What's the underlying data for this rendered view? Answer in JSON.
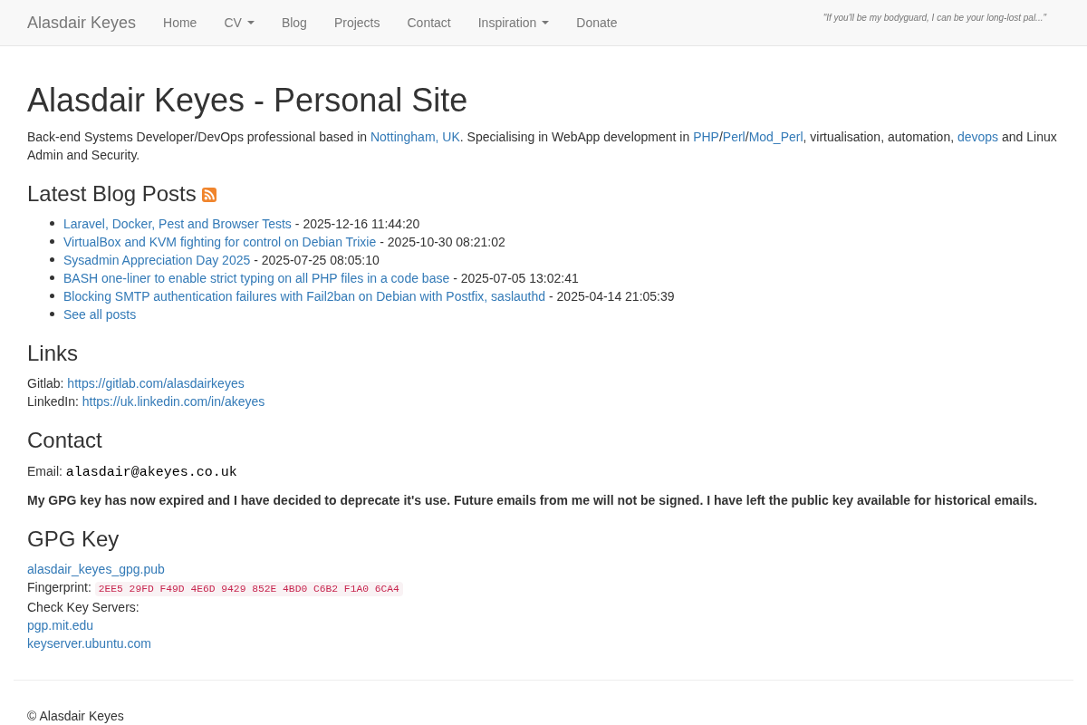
{
  "navbar": {
    "brand": "Alasdair Keyes",
    "items": [
      {
        "label": "Home",
        "kind": "link"
      },
      {
        "label": "CV",
        "kind": "dropdown"
      },
      {
        "label": "Blog",
        "kind": "link"
      },
      {
        "label": "Projects",
        "kind": "link"
      },
      {
        "label": "Contact",
        "kind": "link"
      },
      {
        "label": "Inspiration",
        "kind": "dropdown"
      },
      {
        "label": "Donate",
        "kind": "link"
      }
    ],
    "quote": "\"If you'll be my bodyguard, I can be your long-lost pal...\""
  },
  "header": {
    "title": "Alasdair Keyes - Personal Site",
    "intro": [
      {
        "kind": "text",
        "text": "Back-end Systems Developer/DevOps professional based in "
      },
      {
        "kind": "link",
        "text": "Nottingham, UK"
      },
      {
        "kind": "text",
        "text": ". Specialising in WebApp development in "
      },
      {
        "kind": "link",
        "text": "PHP"
      },
      {
        "kind": "text",
        "text": "/"
      },
      {
        "kind": "link",
        "text": "Perl"
      },
      {
        "kind": "text",
        "text": "/"
      },
      {
        "kind": "link",
        "text": "Mod_Perl"
      },
      {
        "kind": "text",
        "text": ", virtualisation, automation, "
      },
      {
        "kind": "link",
        "text": "devops"
      },
      {
        "kind": "text",
        "text": " and Linux Admin and Security."
      }
    ]
  },
  "blog": {
    "heading": "Latest Blog Posts",
    "posts": [
      {
        "title": "Laravel, Docker, Pest and Browser Tests",
        "date": "- 2025-12-16 11:44:20"
      },
      {
        "title": "VirtualBox and KVM fighting for control on Debian Trixie",
        "date": "- 2025-10-30 08:21:02"
      },
      {
        "title": "Sysadmin Appreciation Day 2025",
        "date": "- 2025-07-25 08:05:10"
      },
      {
        "title": "BASH one-liner to enable strict typing on all PHP files in a code base",
        "date": "- 2025-07-05 13:02:41"
      },
      {
        "title": "Blocking SMTP authentication failures with Fail2ban on Debian with Postfix, saslauthd",
        "date": "- 2025-04-14 21:05:39"
      }
    ],
    "see_all": "See all posts"
  },
  "links": {
    "heading": "Links",
    "items": [
      {
        "label": "Gitlab:",
        "url": "https://gitlab.com/alasdairkeyes"
      },
      {
        "label": "LinkedIn:",
        "url": "https://uk.linkedin.com/in/akeyes"
      }
    ]
  },
  "contact": {
    "heading": "Contact",
    "email_label": "Email:",
    "email": "alasdair@akeyes.co.uk",
    "notice": "My GPG key has now expired and I have decided to deprecate it's use. Future emails from me will not be signed. I have left the public key available for historical emails."
  },
  "gpg": {
    "heading": "GPG Key",
    "file": "alasdair_keyes_gpg.pub",
    "fingerprint_label": "Fingerprint:",
    "fingerprint": "2EE5 29FD F49D 4E6D 9429 852E 4BD0 C6B2 F1A0 6CA4",
    "servers_label": "Check Key Servers:",
    "servers": [
      "pgp.mit.edu",
      "keyserver.ubuntu.com"
    ]
  },
  "footer": {
    "copyright": "© Alasdair Keyes"
  }
}
